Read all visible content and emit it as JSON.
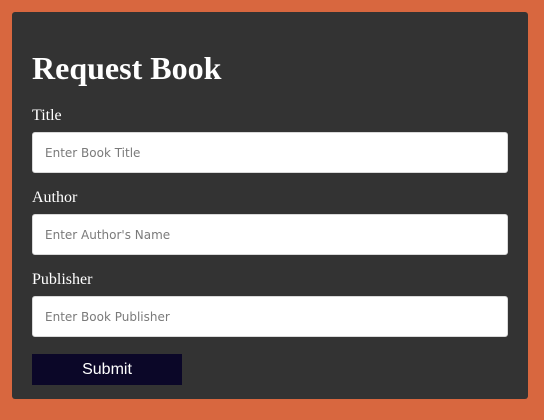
{
  "form": {
    "title": "Request Book",
    "fields": [
      {
        "label": "Title",
        "placeholder": "Enter Book Title",
        "value": ""
      },
      {
        "label": "Author",
        "placeholder": "Enter Author's Name",
        "value": ""
      },
      {
        "label": "Publisher",
        "placeholder": "Enter Book Publisher",
        "value": ""
      }
    ],
    "submit_label": "Submit"
  },
  "colors": {
    "page_background": "#d8673f",
    "card_background": "#333333",
    "input_background": "#ffffff",
    "button_background": "#0b0728",
    "text": "#ffffff"
  }
}
